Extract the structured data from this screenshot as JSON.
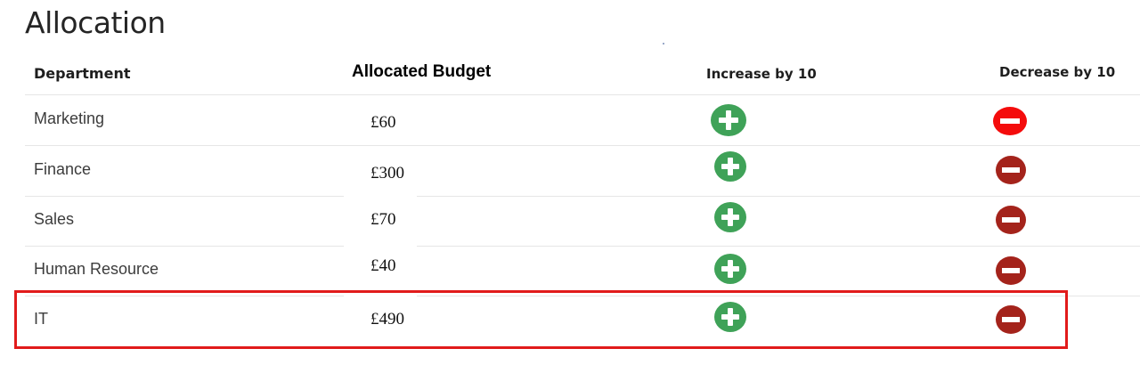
{
  "page": {
    "title": "Allocation"
  },
  "table": {
    "headers": {
      "department": "Department",
      "budget": "Allocated Budget",
      "increase": "Increase by 10",
      "decrease": "Decrease by 10"
    },
    "rows": [
      {
        "department": "Marketing",
        "budget": "£60"
      },
      {
        "department": "Finance",
        "budget": "£300"
      },
      {
        "department": "Sales",
        "budget": "£70"
      },
      {
        "department": "Human Resource",
        "budget": "£40"
      },
      {
        "department": "IT",
        "budget": "£490"
      }
    ]
  },
  "icons": {
    "increase": "plus-circle-icon",
    "decrease": "minus-circle-icon"
  },
  "colors": {
    "increase_button": "#3fa258",
    "decrease_button": "#a4231b",
    "decrease_button_active": "#f40c0c",
    "highlight": "#e11b1b"
  }
}
